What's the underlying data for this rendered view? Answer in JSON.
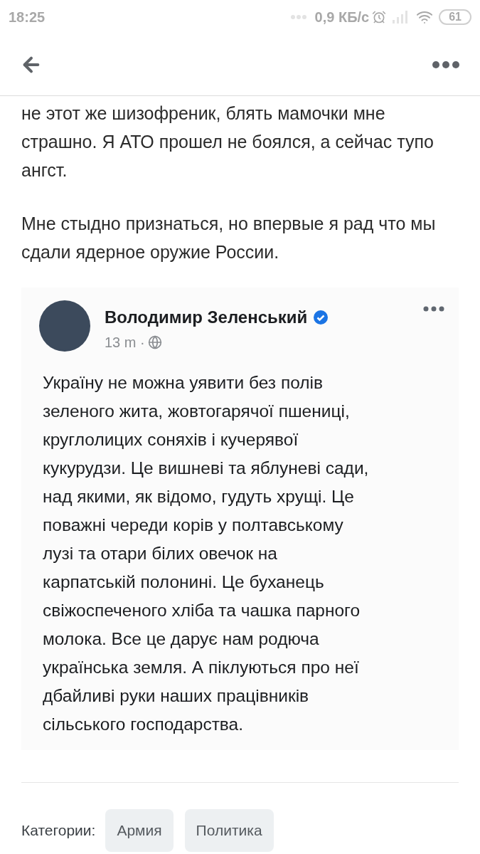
{
  "status_bar": {
    "time": "18:25",
    "speed": "0,9 КБ/с",
    "battery": "61"
  },
  "article": {
    "paragraphs": [
      "не этот же шизофреник, блять мамочки мне страшно. Я АТО прошел не боялся, а сейчас тупо ангст.",
      "Мне стыдно признаться, но впервые я рад что мы сдали ядерное оружие России."
    ]
  },
  "embedded_post": {
    "author": "Володимир Зеленський",
    "verified": true,
    "time": "13 m ·",
    "text": "Україну не можна уявити без полів\nзеленого жита, жовтогарячої пшениці,\nкруглолицих соняхів і кучерявої\nкукурудзи. Це вишневі та яблуневі сади,\nнад якими, як відомо, гудуть хрущі. Це\nповажні череди корів у полтавському\nлузі та отари білих овечок на\nкарпатській полонині. Це буханець\nсвіжоспеченого хліба та чашка парного\nмолока. Все це дарує нам родюча\nукраїнська земля. А піклуються про неї\nдбайливі руки наших працівників\nсільського господарства."
  },
  "categories": {
    "label": "Категории:",
    "tags": [
      "Армия",
      "Политика"
    ]
  }
}
